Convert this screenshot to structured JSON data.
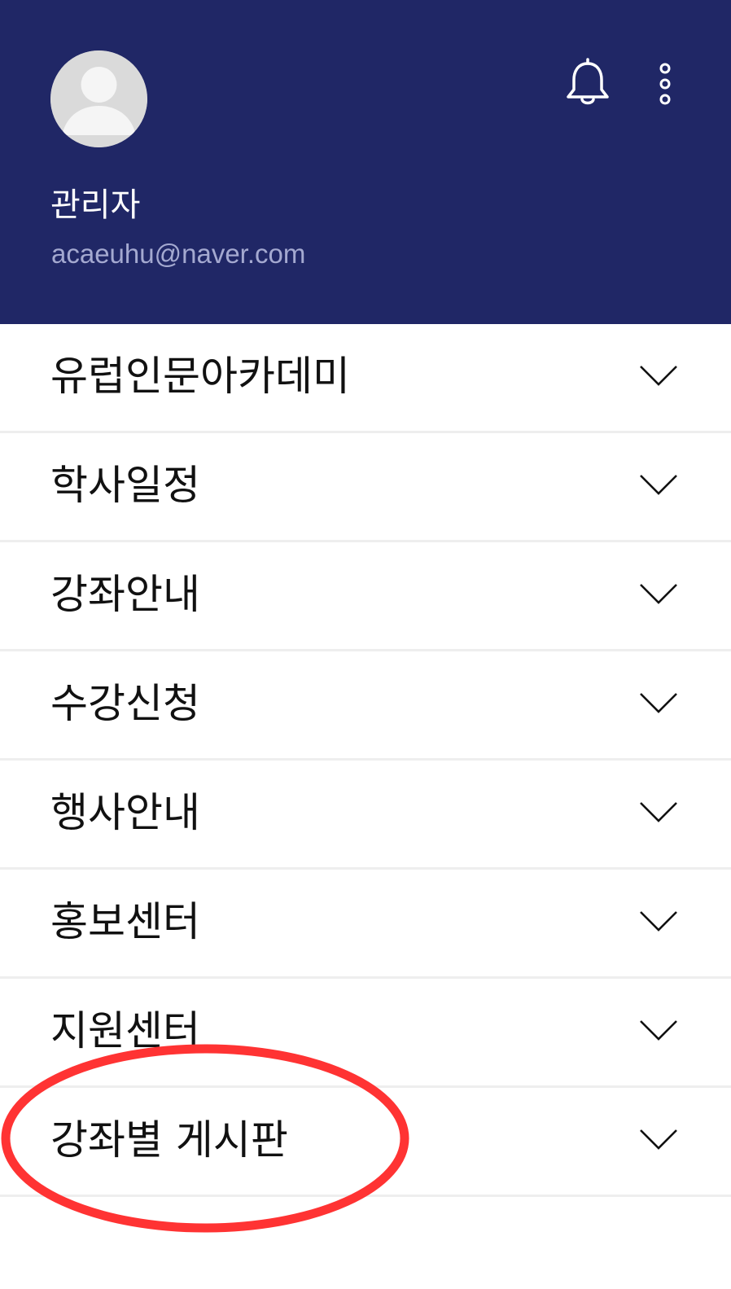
{
  "profile": {
    "name": "관리자",
    "email": "acaeuhu@naver.com",
    "avatar_icon": "default-avatar-icon"
  },
  "header_actions": {
    "notification_icon": "bell-icon",
    "more_icon": "more-vertical-icon"
  },
  "menu": {
    "items": [
      {
        "label": "유럽인문아카데미",
        "icon": "chevron-down-icon"
      },
      {
        "label": "학사일정",
        "icon": "chevron-down-icon"
      },
      {
        "label": "강좌안내",
        "icon": "chevron-down-icon"
      },
      {
        "label": "수강신청",
        "icon": "chevron-down-icon"
      },
      {
        "label": "행사안내",
        "icon": "chevron-down-icon"
      },
      {
        "label": "홍보센터",
        "icon": "chevron-down-icon"
      },
      {
        "label": "지원센터",
        "icon": "chevron-down-icon"
      },
      {
        "label": "강좌별 게시판",
        "icon": "chevron-down-icon"
      }
    ]
  },
  "colors": {
    "header_bg": "#202766",
    "email_text": "#a4a9d0",
    "divider": "#eeeeee",
    "annotation_ring": "#ff3333"
  }
}
